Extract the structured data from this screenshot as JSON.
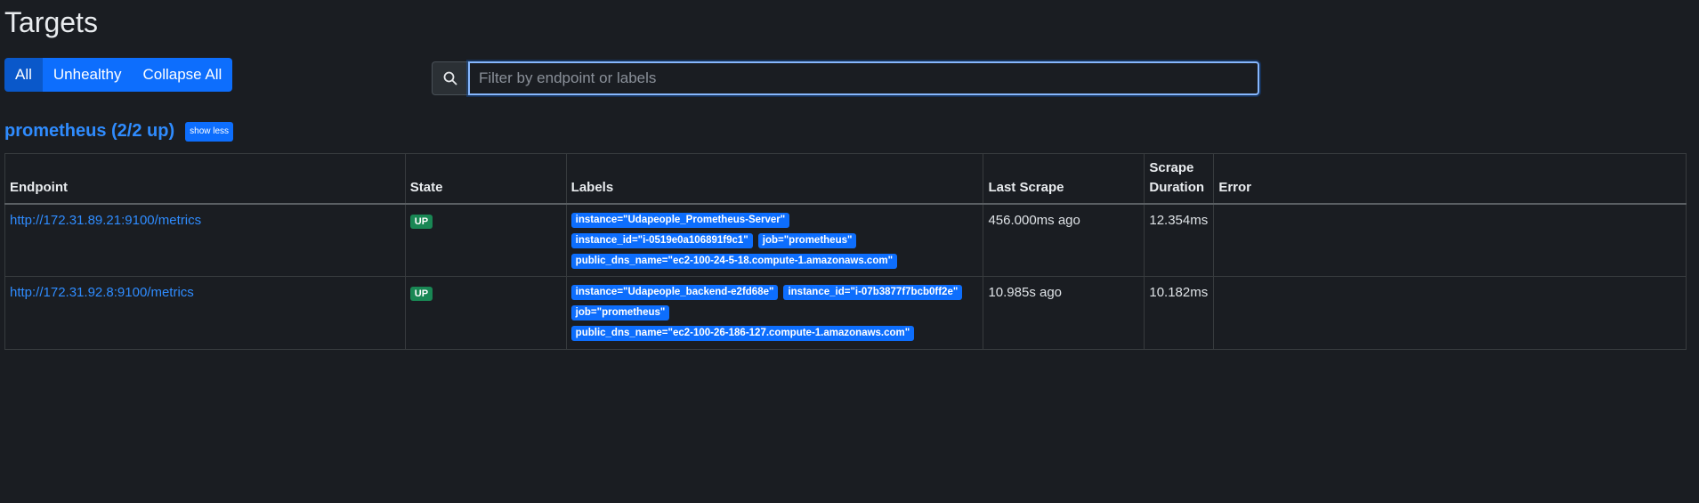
{
  "page": {
    "title": "Targets"
  },
  "filters": {
    "all": "All",
    "unhealthy": "Unhealthy",
    "collapse_all": "Collapse All"
  },
  "search": {
    "placeholder": "Filter by endpoint or labels",
    "value": "",
    "icon": "search-icon"
  },
  "job": {
    "title": "prometheus (2/2 up)",
    "toggle_label": "show less"
  },
  "table": {
    "headers": {
      "endpoint": "Endpoint",
      "state": "State",
      "labels": "Labels",
      "last_scrape": "Last Scrape",
      "scrape_duration_line1": "Scrape",
      "scrape_duration_line2": "Duration",
      "error": "Error"
    },
    "rows": [
      {
        "endpoint": "http://172.31.89.21:9100/metrics",
        "state": "UP",
        "labels": [
          "instance=\"Udapeople_Prometheus-Server\"",
          "instance_id=\"i-0519e0a106891f9c1\"",
          "job=\"prometheus\"",
          "public_dns_name=\"ec2-100-24-5-18.compute-1.amazonaws.com\""
        ],
        "last_scrape": "456.000ms ago",
        "scrape_duration": "12.354ms",
        "error": ""
      },
      {
        "endpoint": "http://172.31.92.8:9100/metrics",
        "state": "UP",
        "labels": [
          "instance=\"Udapeople_backend-e2fd68e\"",
          "instance_id=\"i-07b3877f7bcb0ff2e\"",
          "job=\"prometheus\"",
          "public_dns_name=\"ec2-100-26-186-127.compute-1.amazonaws.com\""
        ],
        "last_scrape": "10.985s ago",
        "scrape_duration": "10.182ms",
        "error": ""
      }
    ]
  },
  "colors": {
    "background": "#1a1d22",
    "accent": "#0d6efd",
    "link": "#2f8cff",
    "state_up": "#198754"
  }
}
